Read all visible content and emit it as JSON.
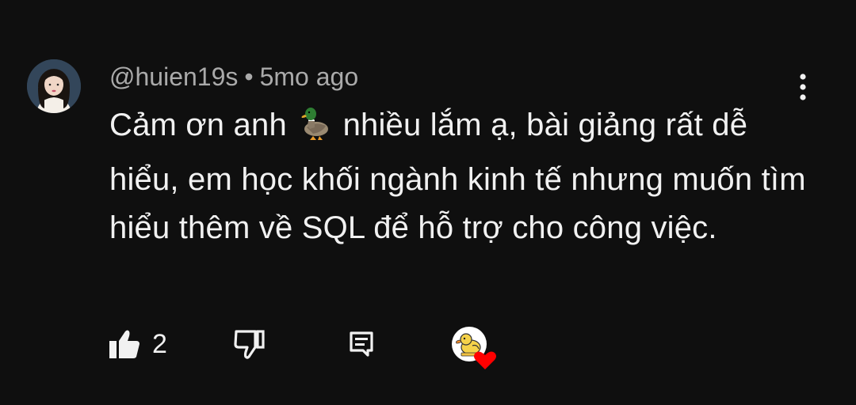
{
  "comment": {
    "author": "@huien19s",
    "separator": "•",
    "time_ago": "5mo ago",
    "text_part1": "Cảm ơn anh",
    "text_part2": "nhiều lắm ạ, bài giảng rất dễ hiểu, em học khối ngành kinh tế nhưng muốn tìm hiểu thêm về SQL để hỗ trợ cho công việc.",
    "emoji": "duck-emoji",
    "like_count": "2"
  },
  "icons": {
    "menu": "vertical-dots-icon",
    "like": "thumb-up-filled-icon",
    "dislike": "thumb-down-outline-icon",
    "reply": "comment-reply-icon",
    "creator_heart": "creator-heart-badge"
  },
  "colors": {
    "background": "#0f0f0f",
    "primary_text": "#f1f1f1",
    "secondary_text": "#aaaaaa",
    "heart": "#ff0000"
  }
}
